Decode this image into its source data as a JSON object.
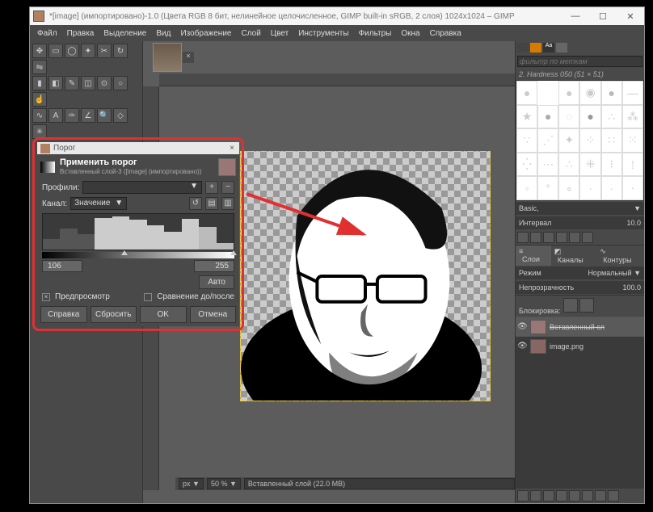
{
  "window": {
    "title": "*[image] (импортировано)-1.0 (Цвета RGB 8 бит, нелинейное целочисленное, GIMP built-in sRGB, 2 слоя) 1024x1024 – GIMP",
    "minimize": "—",
    "maximize": "☐",
    "close": "✕"
  },
  "menu": [
    "Файл",
    "Правка",
    "Выделение",
    "Вид",
    "Изображение",
    "Слой",
    "Цвет",
    "Инструменты",
    "Фильтры",
    "Окна",
    "Справка"
  ],
  "status": {
    "unit": "px",
    "zoom": "50 %",
    "layer_info": "Вставленный слой (22.0 MB)",
    "arrow": "▼"
  },
  "right": {
    "filter_placeholder": "фильтр по меткам",
    "hardness": "2. Hardness 050 (51 × 51)",
    "palette": "Basic,",
    "interval_label": "Интервал",
    "interval_value": "10.0",
    "layers_tab": "Слои",
    "channels_tab": "Каналы",
    "paths_tab": "Контуры",
    "mode_label": "Режим",
    "mode_value": "Нормальный",
    "opacity_label": "Непрозрачность",
    "opacity_value": "100.0",
    "lock_label": "Блокировка:",
    "layer1": "Вставленный сл",
    "layer2": "image.png"
  },
  "dialog": {
    "title": "Порог",
    "header": "Применить порог",
    "subheader": "Вставленный слой-3 ([image] (импортировано))",
    "profiles": "Профили:",
    "channel": "Канал:",
    "channel_value": "Значение",
    "low": "106",
    "high": "255",
    "auto": "Авто",
    "preview": "Предпросмотр",
    "compare": "Сравнение до/после",
    "help": "Справка",
    "reset": "Сбросить",
    "ok": "OK",
    "cancel": "Отмена",
    "plus": "+",
    "minus": "−",
    "dropdown": "▼"
  }
}
